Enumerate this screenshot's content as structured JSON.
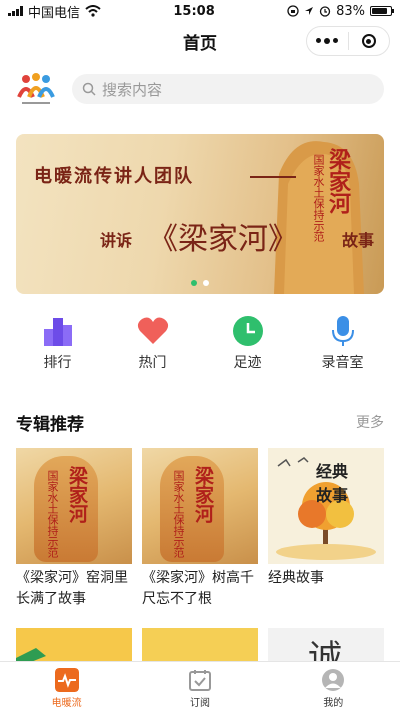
{
  "status": {
    "carrier": "中国电信",
    "time": "15:08",
    "battery": "83%",
    "battery_level": 0.83
  },
  "nav": {
    "title": "首页"
  },
  "search": {
    "placeholder": "搜索内容"
  },
  "banner": {
    "line1": "电暖流传讲人团队",
    "line2a": "讲诉",
    "line2b": "《梁家河》",
    "line2c": "故事",
    "stone_vertical": "国家水土保持示范",
    "stone_big": "梁家河",
    "page_count": 2,
    "active_index": 0
  },
  "quick": [
    {
      "label": "排行",
      "icon": "rank-icon",
      "color": "#7b5cf0"
    },
    {
      "label": "热门",
      "icon": "heart-icon",
      "color": "#f0605a"
    },
    {
      "label": "足迹",
      "icon": "clock-icon",
      "color": "#2fbf6d"
    },
    {
      "label": "录音室",
      "icon": "microphone-icon",
      "color": "#3b8fe6"
    }
  ],
  "albums": {
    "title": "专辑推荐",
    "more": "更多",
    "items": [
      {
        "title": "《梁家河》窑洞里长满了故事",
        "cover_v": "国家水土保持示范",
        "cover_big": "梁家河"
      },
      {
        "title": "《梁家河》树高千尺忘不了根",
        "cover_v": "国家水土保持示范",
        "cover_big": "梁家河"
      },
      {
        "title": "经典故事",
        "cover_text": "经典故事"
      }
    ],
    "row2_cover_text": "诚信"
  },
  "tabs": [
    {
      "label": "电暖流",
      "icon": "pulse-icon"
    },
    {
      "label": "订阅",
      "icon": "subscribe-icon"
    },
    {
      "label": "我的",
      "icon": "profile-icon"
    }
  ],
  "colors": {
    "accent": "#ec6a1e",
    "banner_text": "#7a2416",
    "active_dot": "#2fbf6d"
  }
}
